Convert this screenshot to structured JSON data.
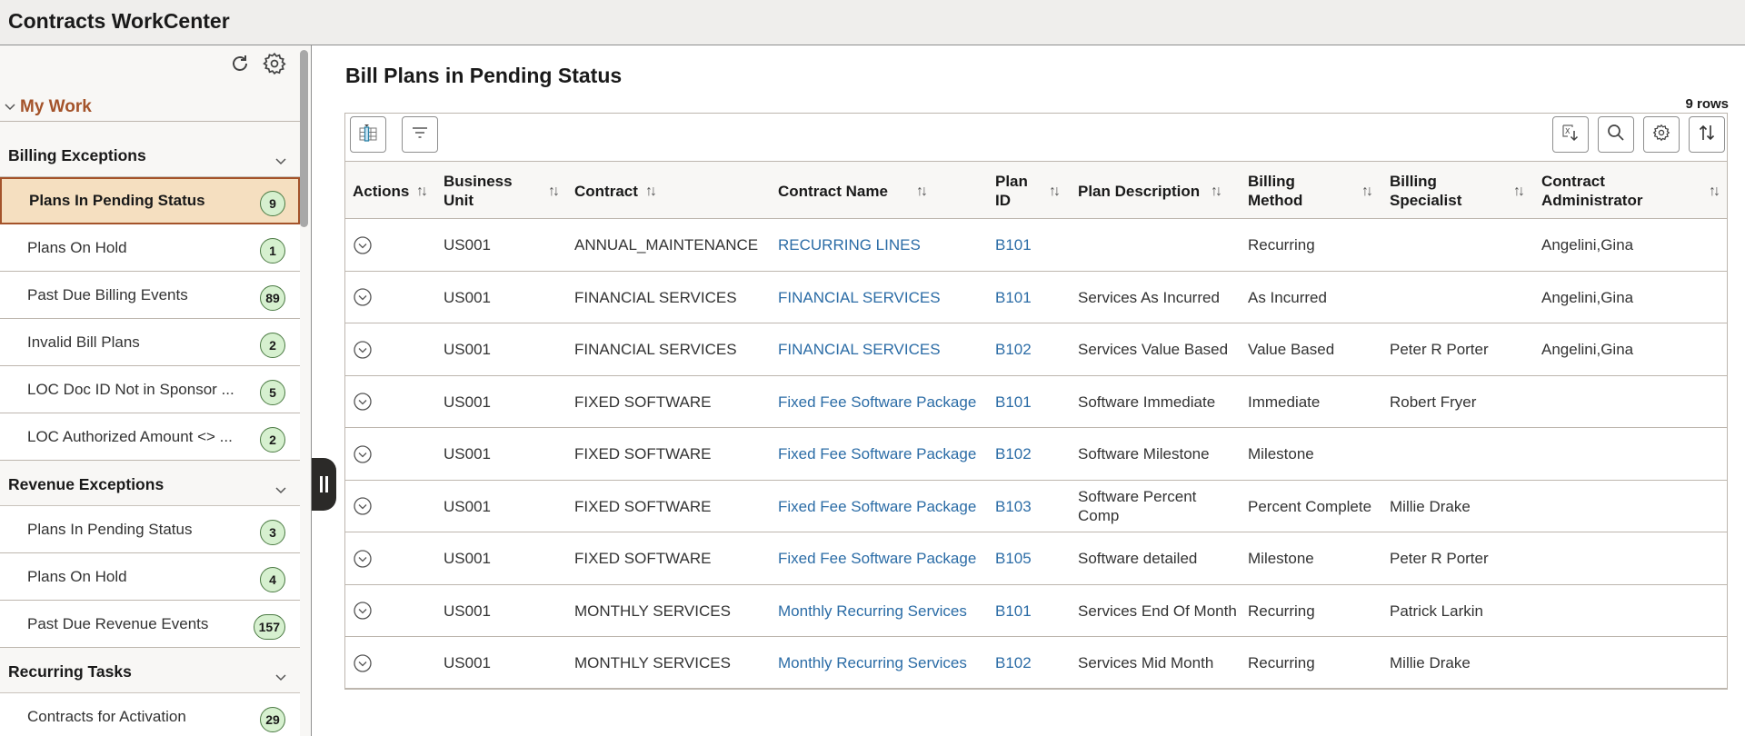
{
  "app": {
    "title": "Contracts WorkCenter"
  },
  "sidebar": {
    "refresh_icon": "refresh-icon",
    "settings_icon": "gear-icon",
    "my_work_label": "My Work",
    "groups": [
      {
        "label": "Billing Exceptions",
        "items": [
          {
            "label": "Plans In Pending Status",
            "count": "9",
            "active": true
          },
          {
            "label": "Plans On Hold",
            "count": "1"
          },
          {
            "label": "Past Due Billing Events",
            "count": "89"
          },
          {
            "label": "Invalid Bill Plans",
            "count": "2"
          },
          {
            "label": "LOC Doc ID Not in Sponsor ...",
            "count": "5"
          },
          {
            "label": "LOC Authorized Amount <> ...",
            "count": "2"
          }
        ]
      },
      {
        "label": "Revenue Exceptions",
        "items": [
          {
            "label": "Plans In Pending Status",
            "count": "3"
          },
          {
            "label": "Plans On Hold",
            "count": "4"
          },
          {
            "label": "Past Due Revenue Events",
            "count": "157"
          }
        ]
      },
      {
        "label": "Recurring Tasks",
        "items": [
          {
            "label": "Contracts for Activation",
            "count": "29"
          }
        ]
      }
    ]
  },
  "main": {
    "title": "Bill Plans in Pending Status",
    "row_count": "9 rows",
    "toolbar": {
      "left": [
        {
          "name": "column-chooser-button",
          "icon": "column-chooser-icon"
        },
        {
          "name": "filter-button",
          "icon": "filter-icon"
        }
      ],
      "right": [
        {
          "name": "export-excel-button",
          "icon": "excel-download-icon"
        },
        {
          "name": "search-button",
          "icon": "search-icon"
        },
        {
          "name": "grid-settings-button",
          "icon": "gear-icon"
        },
        {
          "name": "sort-button",
          "icon": "sort-icon"
        }
      ]
    },
    "columns": [
      "Actions",
      "Business Unit",
      "Contract",
      "Contract Name",
      "Plan ID",
      "Plan Description",
      "Billing Method",
      "Billing Specialist",
      "Contract Administrator"
    ],
    "rows": [
      {
        "business_unit": "US001",
        "contract": "ANNUAL_MAINTENANCE",
        "contract_name": "RECURRING LINES",
        "plan_id": "B101",
        "plan_description": "",
        "billing_method": "Recurring",
        "billing_specialist": "",
        "contract_administrator": "Angelini,Gina"
      },
      {
        "business_unit": "US001",
        "contract": "FINANCIAL SERVICES",
        "contract_name": "FINANCIAL SERVICES",
        "plan_id": "B101",
        "plan_description": "Services As Incurred",
        "billing_method": "As Incurred",
        "billing_specialist": "",
        "contract_administrator": "Angelini,Gina"
      },
      {
        "business_unit": "US001",
        "contract": "FINANCIAL SERVICES",
        "contract_name": "FINANCIAL SERVICES",
        "plan_id": "B102",
        "plan_description": "Services Value Based",
        "billing_method": "Value Based",
        "billing_specialist": "Peter R Porter",
        "contract_administrator": "Angelini,Gina"
      },
      {
        "business_unit": "US001",
        "contract": "FIXED SOFTWARE",
        "contract_name": "Fixed Fee Software Package",
        "plan_id": "B101",
        "plan_description": "Software Immediate",
        "billing_method": "Immediate",
        "billing_specialist": "Robert Fryer",
        "contract_administrator": ""
      },
      {
        "business_unit": "US001",
        "contract": "FIXED SOFTWARE",
        "contract_name": "Fixed Fee Software Package",
        "plan_id": "B102",
        "plan_description": "Software Milestone",
        "billing_method": "Milestone",
        "billing_specialist": "",
        "contract_administrator": ""
      },
      {
        "business_unit": "US001",
        "contract": "FIXED SOFTWARE",
        "contract_name": "Fixed Fee Software Package",
        "plan_id": "B103",
        "plan_description": "Software Percent Comp",
        "billing_method": "Percent Complete",
        "billing_specialist": "Millie Drake",
        "contract_administrator": ""
      },
      {
        "business_unit": "US001",
        "contract": "FIXED SOFTWARE",
        "contract_name": "Fixed Fee Software Package",
        "plan_id": "B105",
        "plan_description": "Software detailed",
        "billing_method": "Milestone",
        "billing_specialist": "Peter R Porter",
        "contract_administrator": ""
      },
      {
        "business_unit": "US001",
        "contract": "MONTHLY SERVICES",
        "contract_name": "Monthly Recurring Services",
        "plan_id": "B101",
        "plan_description": "Services End Of Month",
        "billing_method": "Recurring",
        "billing_specialist": "Patrick Larkin",
        "contract_administrator": ""
      },
      {
        "business_unit": "US001",
        "contract": "MONTHLY SERVICES",
        "contract_name": "Monthly Recurring Services",
        "plan_id": "B102",
        "plan_description": "Services Mid Month",
        "billing_method": "Recurring",
        "billing_specialist": "Millie Drake",
        "contract_administrator": ""
      }
    ]
  },
  "colors": {
    "accent": "#a4532a",
    "active_bg": "#f5dfc0",
    "badge_bg": "#d6f0cf",
    "link": "#2b6ca6",
    "header_bg": "#efeeec"
  }
}
